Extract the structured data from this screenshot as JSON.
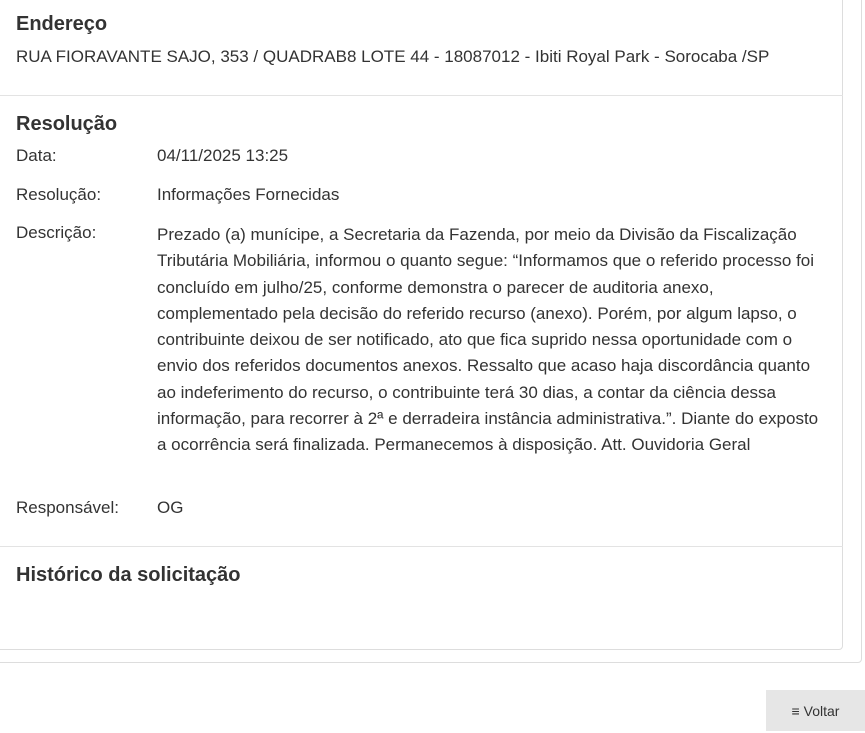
{
  "address": {
    "title": "Endereço",
    "text": "RUA FIORAVANTE SAJO, 353 / QUADRAB8 LOTE 44 - 18087012 - Ibiti Royal Park - Sorocaba /SP"
  },
  "resolution": {
    "title": "Resolução",
    "date_label": "Data:",
    "date_value": "04/11/2025 13:25",
    "resolution_label": "Resolução:",
    "resolution_value": "Informações Fornecidas",
    "description_label": "Descrição:",
    "description_value": "Prezado (a) munícipe, a Secretaria da Fazenda, por meio da Divisão da Fiscalização Tributária Mobiliária, informou o quanto segue: “Informamos que o referido processo foi concluído em julho/25,  conforme demonstra o parecer de auditoria anexo, complementado pela decisão do referido recurso (anexo). Porém, por algum lapso,  o contribuinte deixou de ser notificado,  ato que fica suprido nessa oportunidade com o envio dos referidos documentos anexos. Ressalto que acaso haja discordância quanto ao indeferimento do recurso, o contribuinte terá 30 dias, a contar da ciência dessa informação,  para recorrer à 2ª e derradeira instância administrativa.”. Diante do exposto a ocorrência será finalizada. Permanecemos à disposição. Att. Ouvidoria Geral",
    "responsible_label": "Responsável:",
    "responsible_value": "OG"
  },
  "history": {
    "title": "Histórico da solicitação"
  },
  "actions": {
    "back_icon": "list-icon",
    "back_icon_glyph": "≡",
    "back_label": "Voltar"
  }
}
